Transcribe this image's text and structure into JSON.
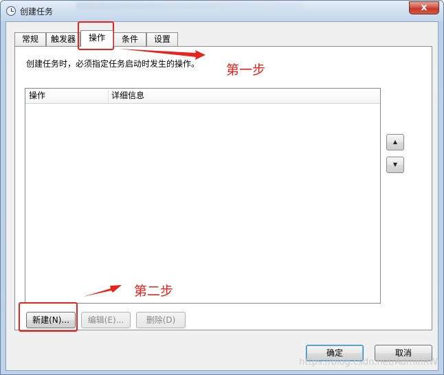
{
  "window": {
    "title": "创建任务",
    "close_label": "x"
  },
  "tabs": [
    {
      "label": "常规"
    },
    {
      "label": "触发器"
    },
    {
      "label": "操作"
    },
    {
      "label": "条件"
    },
    {
      "label": "设置"
    }
  ],
  "active_tab": "操作",
  "panel": {
    "description": "创建任务时，必须指定任务启动时发生的操作。",
    "columns": [
      "操作",
      "详细信息"
    ],
    "rows": []
  },
  "side_buttons": {
    "up_icon": "▲",
    "down_icon": "▼"
  },
  "action_buttons": {
    "new": "新建(N)...",
    "edit": "编辑(E)...",
    "delete": "删除(D)"
  },
  "dialog_buttons": {
    "ok": "确定",
    "cancel": "取消"
  },
  "annotations": {
    "step1": "第一步",
    "step2": "第二步"
  },
  "watermark": "https://blog.csdn.net/AdminRW",
  "colors": {
    "annotation_red": "#e8231b",
    "titlebar": "#c9dcee"
  }
}
